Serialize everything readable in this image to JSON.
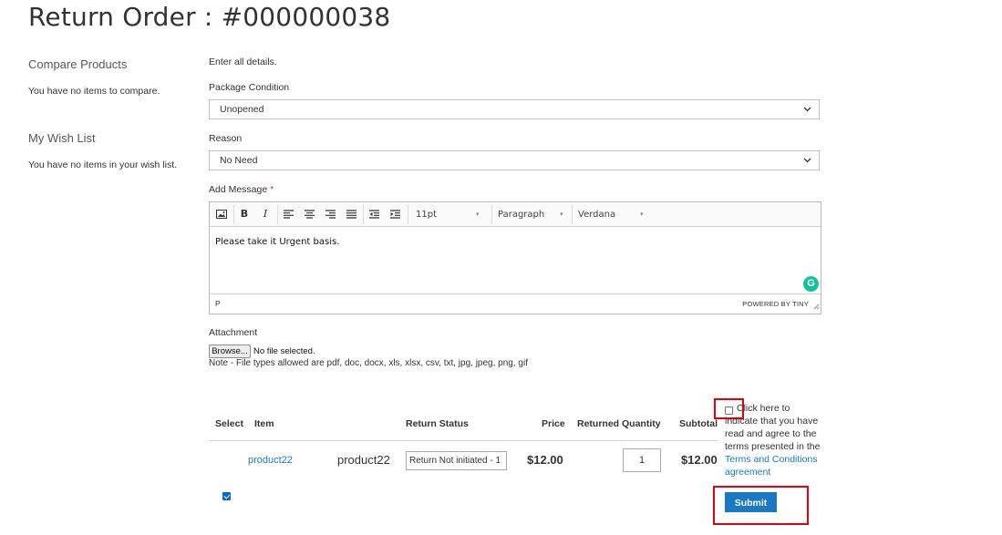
{
  "page": {
    "title": "Return Order : #000000038"
  },
  "sidebar": {
    "compare": {
      "title": "Compare Products",
      "empty": "You have no items to compare."
    },
    "wishlist": {
      "title": "My Wish List",
      "empty": "You have no items in your wish list."
    }
  },
  "form": {
    "intro": "Enter all details.",
    "package_condition": {
      "label": "Package Condition",
      "value": "Unopened"
    },
    "reason": {
      "label": "Reason",
      "value": "No Need"
    },
    "message": {
      "label": "Add Message",
      "required_mark": "*",
      "toolbar": {
        "font_size": "11pt",
        "block_format": "Paragraph",
        "font_family": "Verdana"
      },
      "content": "Please take it Urgent basis.",
      "path": "P",
      "powered_by": "POWERED BY TINY"
    },
    "attachment": {
      "label": "Attachment",
      "browse_label": "Browse...",
      "file_status": "No file selected.",
      "note": "Note - File types allowed are pdf, doc, docx, xls, xlsx, csv, txt, jpg, jpeg, png, gif"
    }
  },
  "table": {
    "headers": {
      "select": "Select",
      "item": "Item",
      "return_status": "Return Status",
      "price": "Price",
      "returned_quantity": "Returned Quantity",
      "subtotal": "Subtotal"
    },
    "rows": [
      {
        "item_link": "product22",
        "item_name": "product22",
        "return_status": "Return Not initiated - 1",
        "price": "$12.00",
        "quantity": "1",
        "subtotal": "$12.00",
        "selected": true
      }
    ]
  },
  "terms": {
    "text": "Click here to indicate that you have read and agree to the terms presented in the ",
    "link": "Terms and Conditions agreement",
    "checked": false
  },
  "actions": {
    "submit_label": "Submit"
  },
  "colors": {
    "accent": "#1979c3",
    "highlight_box": "#e4000f",
    "required": "#e02b27"
  }
}
